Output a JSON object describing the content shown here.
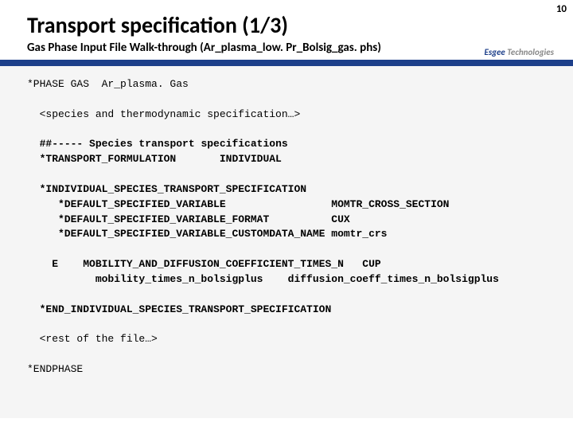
{
  "page_number": "10",
  "title": "Transport specification (1/3)",
  "subtitle": "Gas Phase Input File Walk-through (Ar_plasma_low. Pr_Bolsig_gas. phs)",
  "brand": {
    "name": "Esgee",
    "word": "Technologies"
  },
  "code": {
    "l1": "*PHASE GAS  Ar_plasma. Gas",
    "l2": "  <species and thermodynamic specification…>",
    "l3a": "  ##",
    "l3b": "----- Species transport specifications",
    "l4": "  *TRANSPORT_FORMULATION       INDIVIDUAL",
    "l5": "  *INDIVIDUAL_SPECIES_TRANSPORT_SPECIFICATION",
    "l6": "     *DEFAULT_SPECIFIED_VARIABLE                 MOMTR_CROSS_SECTION",
    "l7": "     *DEFAULT_SPECIFIED_VARIABLE_FORMAT          CUX",
    "l8": "     *DEFAULT_SPECIFIED_VARIABLE_CUSTOMDATA_NAME momtr_crs",
    "l9": "    E    MOBILITY_AND_DIFFUSION_COEFFICIENT_TIMES_N   CUP",
    "l10": "           mobility_times_n_bolsigplus    diffusion_coeff_times_n_bolsigplus",
    "l11": "  *END_INDIVIDUAL_SPECIES_TRANSPORT_SPECIFICATION",
    "l12": "  <rest of the file…>",
    "l13": "*ENDPHASE"
  }
}
